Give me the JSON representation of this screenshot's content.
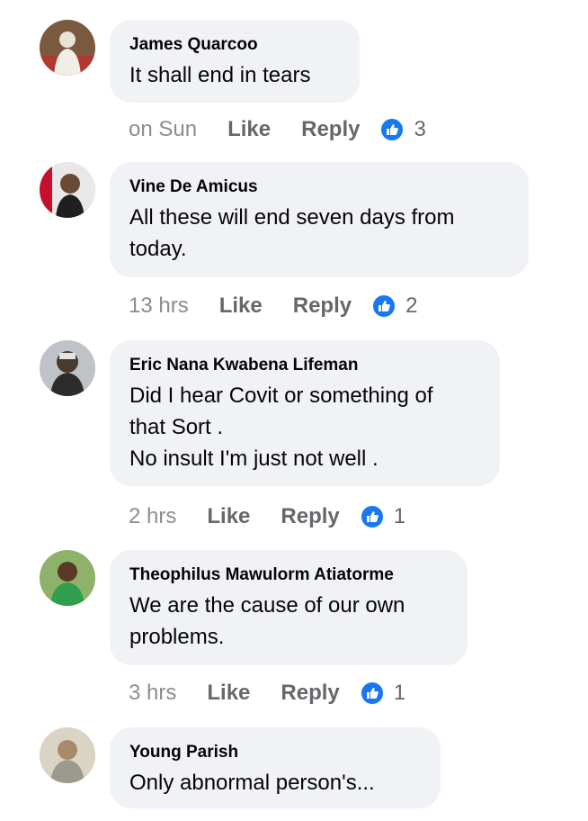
{
  "colors": {
    "bubble": "#f0f2f5",
    "like_badge": "#1877f2",
    "meta": "#65676b"
  },
  "comments": [
    {
      "author": "James Quarcoo",
      "text": "It shall end in tears",
      "time": "on Sun",
      "like_label": "Like",
      "reply_label": "Reply",
      "reaction_count": "3",
      "avatar_icon": "person-avatar-icon"
    },
    {
      "author": "Vine De Amicus",
      "text": "All these will end seven days from\ntoday.",
      "time": "13 hrs",
      "like_label": "Like",
      "reply_label": "Reply",
      "reaction_count": "2",
      "avatar_icon": "person-avatar-icon"
    },
    {
      "author": "Eric Nana Kwabena Lifeman",
      "text": "Did I hear Covit or something of\nthat Sort .\nNo insult I'm just not well .",
      "time": "2 hrs",
      "like_label": "Like",
      "reply_label": "Reply",
      "reaction_count": "1",
      "avatar_icon": "person-avatar-icon"
    },
    {
      "author": "Theophilus Mawulorm Atiatorme",
      "text": "We are the cause of our own\nproblems.",
      "time": "3 hrs",
      "like_label": "Like",
      "reply_label": "Reply",
      "reaction_count": "1",
      "avatar_icon": "person-avatar-icon"
    },
    {
      "author": "Young Parish",
      "text": " Only abnormal person's...",
      "avatar_icon": "person-avatar-icon"
    }
  ]
}
